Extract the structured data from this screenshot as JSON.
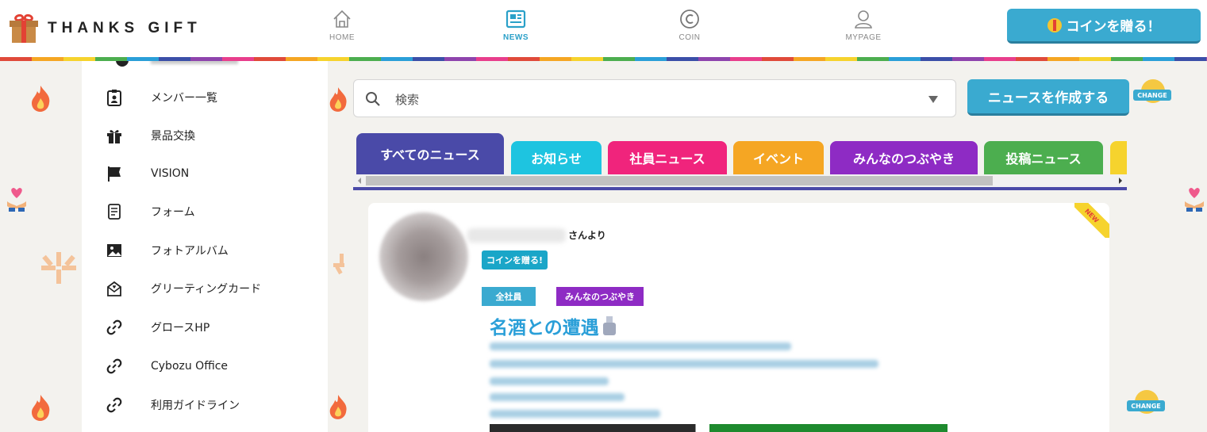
{
  "header": {
    "logo_text": "THANKS GIFT",
    "nav": [
      {
        "label": "HOME",
        "icon": "home-icon"
      },
      {
        "label": "NEWS",
        "icon": "news-icon",
        "active": true
      },
      {
        "label": "COIN",
        "icon": "coin-icon"
      },
      {
        "label": "MYPAGE",
        "icon": "user-icon"
      }
    ],
    "send_coin_label": "コインを贈る！"
  },
  "sidebar": {
    "items": [
      {
        "label": "メンバー一覧",
        "icon": "member-list-icon"
      },
      {
        "label": "景品交換",
        "icon": "gift-icon"
      },
      {
        "label": "VISION",
        "icon": "flag-icon"
      },
      {
        "label": "フォーム",
        "icon": "form-icon"
      },
      {
        "label": "フォトアルバム",
        "icon": "photo-icon"
      },
      {
        "label": "グリーティングカード",
        "icon": "greeting-card-icon"
      },
      {
        "label": "グロースHP",
        "icon": "link-icon"
      },
      {
        "label": "Cybozu Office",
        "icon": "link-icon"
      },
      {
        "label": "利用ガイドライン",
        "icon": "link-icon"
      }
    ]
  },
  "search": {
    "placeholder": "検索"
  },
  "create_news_label": "ニュースを作成する",
  "tabs": [
    {
      "label": "すべてのニュース",
      "color": "#4a4aa8",
      "active": true
    },
    {
      "label": "お知らせ",
      "color": "#1ec4e0"
    },
    {
      "label": "社員ニュース",
      "color": "#f0247c"
    },
    {
      "label": "イベント",
      "color": "#f5a623"
    },
    {
      "label": "みんなのつぶやき",
      "color": "#8e2bc4"
    },
    {
      "label": "投稿ニュース",
      "color": "#4cae4f"
    }
  ],
  "news_card": {
    "sender_suffix": "さんより",
    "send_coin_label": "コインを贈る!",
    "tags": [
      {
        "label": "全社員",
        "color": "#3aaad0"
      },
      {
        "label": "みんなのつぶやき",
        "color": "#8e2bc4"
      }
    ],
    "title": "名酒との遭遇",
    "new_badge": "NEW"
  },
  "change_label": "CHANGE",
  "colors": {
    "accent": "#3aaad0",
    "background": "#f3f2ee"
  }
}
